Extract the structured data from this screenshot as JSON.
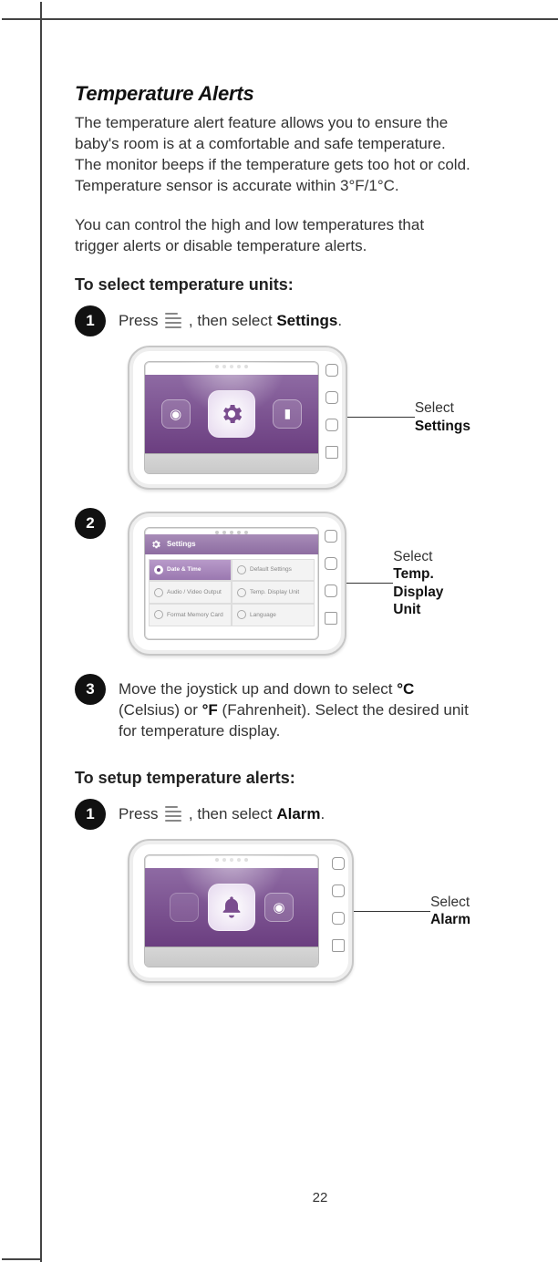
{
  "title": "Temperature Alerts",
  "intro": "The temperature alert feature allows you to ensure the baby's room is at a comfortable and safe temperature. The monitor beeps if the temperature gets too hot or cold. Temperature sensor is accurate within 3°F/1°C.",
  "intro2": "You can control the high and low temperatures that trigger alerts or disable temperature alerts.",
  "section1_head": "To select temperature units:",
  "section2_head": "To setup temperature alerts:",
  "step1_num": "1",
  "step2_num": "2",
  "step3_num": "3",
  "step1_pre": "Press ",
  "step1_post": ", then select ",
  "step1_bold": "Settings",
  "step1_end": ".",
  "step3_text_pre": "Move the joystick up and down to select ",
  "step3_boldC": "°C",
  "step3_mid1": " (Celsius) or ",
  "step3_boldF": "°F",
  "step3_mid2": " (Fahrenheit). Select the desired unit for temperature display.",
  "sec2_step1_pre": "Press ",
  "sec2_step1_post": ", then select ",
  "sec2_step1_bold": "Alarm",
  "sec2_step1_end": ".",
  "callout1_pre": "Select",
  "callout1_bold": "Settings",
  "callout2_pre": "Select ",
  "callout2_bold1": "Temp.",
  "callout2_bold2": "Display Unit",
  "callout3_pre": "Select",
  "callout3_bold": "Alarm",
  "screen2": {
    "header": "Settings",
    "cell1": "Date & Time",
    "cell2": "Default Settings",
    "cell3": "Audio / Video Output",
    "cell4": "Temp. Display Unit",
    "cell5": "Format Memory Card",
    "cell6": "Language"
  },
  "page_number": "22"
}
